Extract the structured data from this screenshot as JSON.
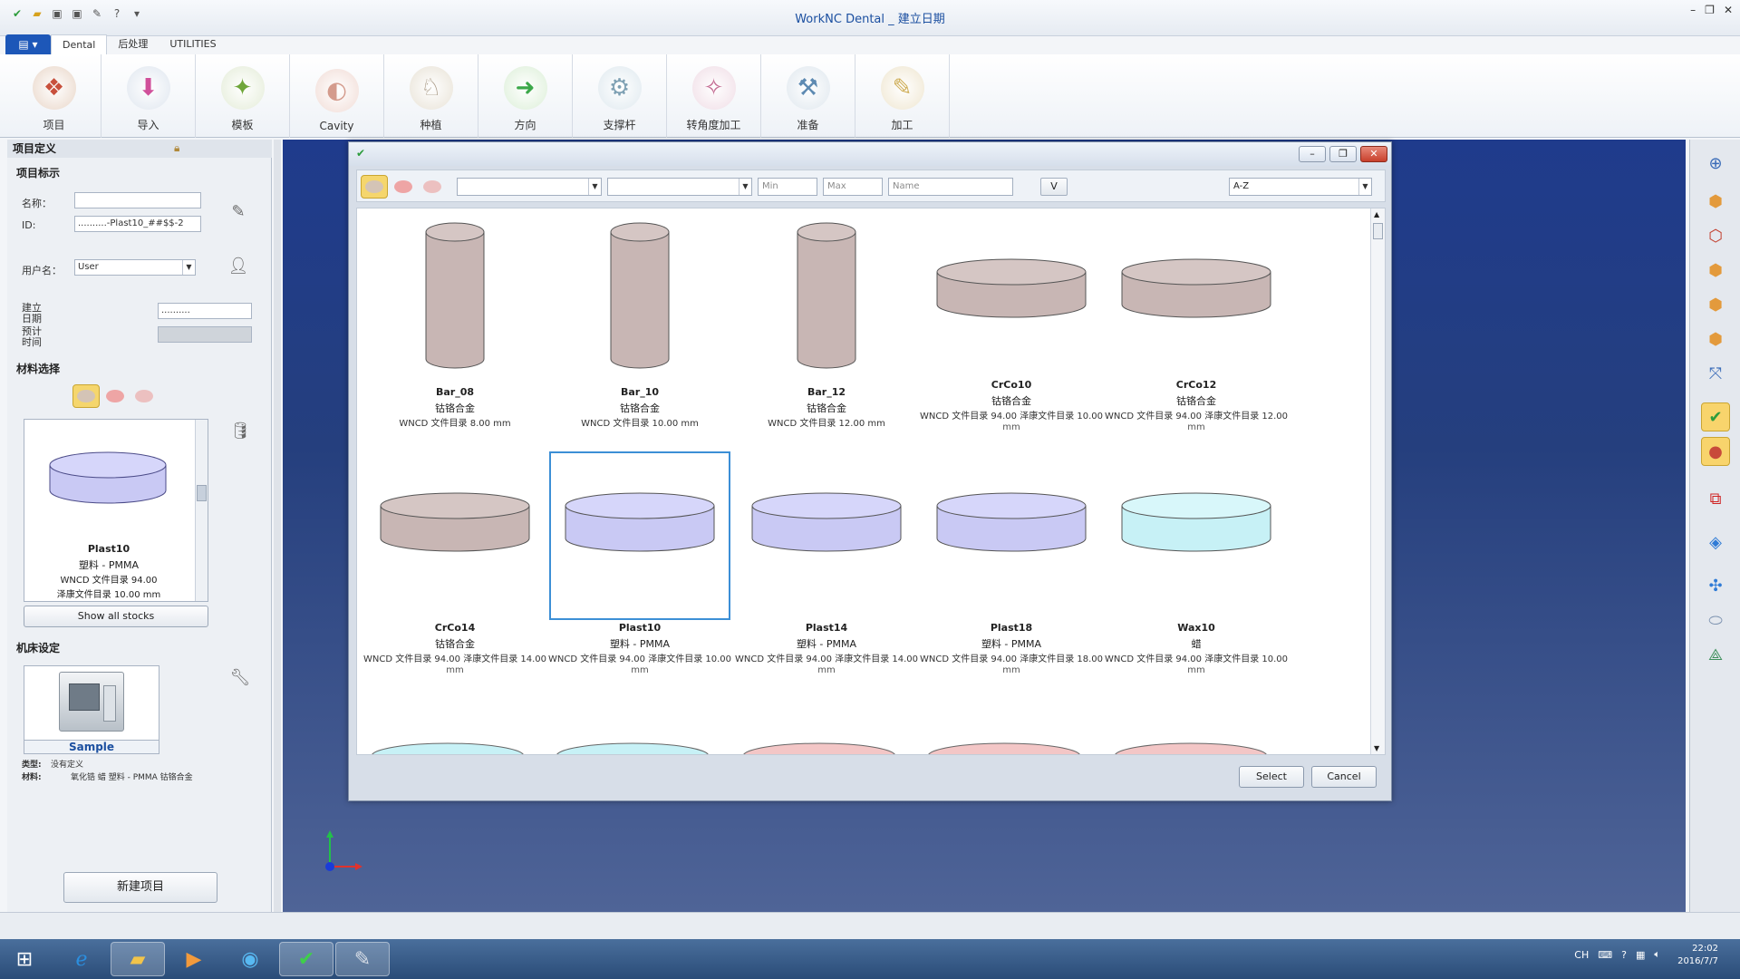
{
  "window": {
    "title": "WorkNC  Dental  _ 建立日期",
    "tabs": [
      "Dental",
      "后处理",
      "UTILITIES"
    ],
    "active_tab": "Dental"
  },
  "ribbon": {
    "buttons": [
      {
        "label": "项目",
        "icon": "project-icon"
      },
      {
        "label": "导入",
        "icon": "import-icon"
      },
      {
        "label": "模板",
        "icon": "template-icon"
      },
      {
        "label": "Cavity",
        "icon": "cavity-icon"
      },
      {
        "label": "种植",
        "icon": "implant-icon"
      },
      {
        "label": "方向",
        "icon": "orientation-icon"
      },
      {
        "label": "支撑杆",
        "icon": "support-icon"
      },
      {
        "label": "转角度加工",
        "icon": "angle-machining-icon"
      },
      {
        "label": "准备",
        "icon": "prepare-icon"
      },
      {
        "label": "加工",
        "icon": "machining-icon"
      }
    ]
  },
  "left_panel": {
    "section_title": "项目定义",
    "project_id_title": "项目标示",
    "name_label": "名称：",
    "name_value": "",
    "id_label": "ID:",
    "id_value": "..........-Plast10_##$$-2",
    "user_label": "用户名：",
    "user_value": "User",
    "created_label_1": "建立",
    "created_label_2": "日期",
    "created_value": "..........",
    "estimated_label_1": "预计",
    "estimated_label_2": "时间",
    "material_title": "材料选择",
    "current_stock": {
      "name": "Plast10",
      "material": "塑料 - PMMA",
      "line1": "WNCD 文件目录 94.00",
      "line2": "泽康文件目录 10.00 mm"
    },
    "show_all_label": "Show all stocks",
    "machine_title": "机床设定",
    "machine_name": "Sample",
    "type_label": "类型:",
    "type_value": "没有定义",
    "materials_label": "材料:",
    "materials_value": "氧化锆 蜡 塑料 - PMMA 钴铬合金",
    "new_project_label": "新建项目"
  },
  "dialog": {
    "filter": {
      "min_placeholder": "Min",
      "max_placeholder": "Max",
      "name_placeholder": "Name",
      "v_label": "V",
      "sort_value": "A-Z"
    },
    "stocks": [
      {
        "name": "Bar_08",
        "material": "钴铬合金",
        "dims": "WNCD 文件目录 8.00 mm",
        "unit": "",
        "shape": "bar",
        "color": "#c8b6b4"
      },
      {
        "name": "Bar_10",
        "material": "钴铬合金",
        "dims": "WNCD 文件目录 10.00 mm",
        "unit": "",
        "shape": "bar",
        "color": "#c8b6b4"
      },
      {
        "name": "Bar_12",
        "material": "钴铬合金",
        "dims": "WNCD 文件目录 12.00 mm",
        "unit": "",
        "shape": "bar",
        "color": "#c8b6b4"
      },
      {
        "name": "CrCo10",
        "material": "钴铬合金",
        "dims": "WNCD 文件目录 94.00 泽康文件目录 10.00",
        "unit": "mm",
        "shape": "disc",
        "color": "#c8b6b4"
      },
      {
        "name": "CrCo12",
        "material": "钴铬合金",
        "dims": "WNCD 文件目录 94.00 泽康文件目录 12.00",
        "unit": "mm",
        "shape": "disc",
        "color": "#c8b6b4"
      },
      {
        "name": "CrCo14",
        "material": "钴铬合金",
        "dims": "WNCD 文件目录 94.00 泽康文件目录 14.00",
        "unit": "mm",
        "shape": "disc",
        "color": "#c8b6b4"
      },
      {
        "name": "Plast10",
        "material": "塑料 - PMMA",
        "dims": "WNCD 文件目录 94.00 泽康文件目录 10.00",
        "unit": "mm",
        "shape": "disc",
        "color": "#c9c9f4",
        "selected": true
      },
      {
        "name": "Plast14",
        "material": "塑料 - PMMA",
        "dims": "WNCD 文件目录 94.00 泽康文件目录 14.00",
        "unit": "mm",
        "shape": "disc",
        "color": "#c9c9f4"
      },
      {
        "name": "Plast18",
        "material": "塑料 - PMMA",
        "dims": "WNCD 文件目录 94.00 泽康文件目录 18.00",
        "unit": "mm",
        "shape": "disc",
        "color": "#c9c9f4"
      },
      {
        "name": "Wax10",
        "material": "蜡",
        "dims": "WNCD 文件目录 94.00 泽康文件目录 10.00",
        "unit": "mm",
        "shape": "disc",
        "color": "#c7f1f6"
      }
    ],
    "select_label": "Select",
    "cancel_label": "Cancel"
  },
  "taskbar": {
    "lang": "CH",
    "time": "22:02",
    "date": "2016/7/7"
  },
  "colors": {
    "metal": "#c8b6b4",
    "pmma": "#c9c9f4",
    "wax": "#c7f1f6",
    "zirconia": "#f3c6c6",
    "selection": "#3c8fd6",
    "viewport": "#233e88"
  }
}
